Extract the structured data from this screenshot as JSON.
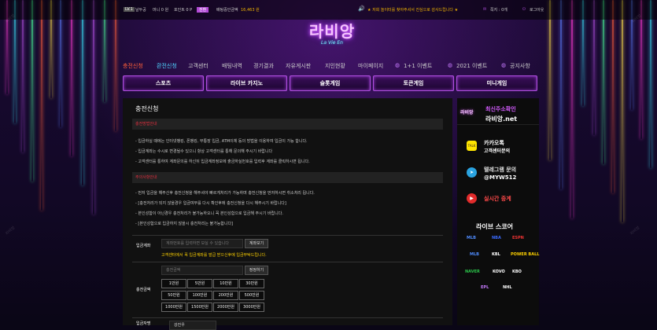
{
  "colors": {
    "accent": "#b04fe0",
    "brand_pink": "#f6c4ff",
    "warn_red": "#e02f3e",
    "warn_yellow": "#ffd200",
    "nav_active": "#ff5f3a"
  },
  "topbar": {
    "level": "LV.1",
    "username": "날두공",
    "money": "머니 0 원",
    "point": "포인트 0 P",
    "exchange": "전환",
    "hold_label": "배팅중인금액",
    "hold_value": "16,463 원",
    "marquee": "★ 저희 놀이터를 찾아주셔서 진심으로 감사드립니다 ★",
    "messages": "쪽지 : 0개",
    "logout": "로그아웃"
  },
  "logo": {
    "main": "라비앙",
    "sub": "La Vie En"
  },
  "nav": {
    "items": [
      {
        "label": "충전신청"
      },
      {
        "label": "환전신청"
      },
      {
        "label": "고객센터"
      },
      {
        "label": "배팅내역"
      },
      {
        "label": "경기결과"
      },
      {
        "label": "자유게시판"
      },
      {
        "label": "지인현황"
      },
      {
        "label": "마이페이지"
      },
      {
        "label": "1+1 이벤트"
      },
      {
        "label": "2021 이벤트"
      },
      {
        "label": "공지사항"
      }
    ]
  },
  "categories": [
    "스포츠",
    "라이브 카지노",
    "슬롯게임",
    "토큰게임",
    "미니게임"
  ],
  "main": {
    "title": "충전신청",
    "section1": "충전방법안내",
    "section1_lines": [
      "- 입금하실 때에는 인터넷뱅킹, 폰뱅킹, 무통장 입금, ATM이체 등의 방법을 이용하여 입금이 가능 합니다.",
      "- 입금계좌는 수시로 변경될수 있으니 항상 고객센터를 통해 문의해 주시기 바랍니다",
      "- 고객센터를 통하여 계좌문의를 하신뒤 입금계좌정보에 출금하실번호를 입력후 계좌를 클릭하시면 됩니다."
    ],
    "section2": "주의사항안내",
    "section2_lines": [
      "- 먼저 입금을 해주신후 충전신청을 해주셔야 빠르게처리가 가능하며 충전신청을 먼저하시면 취소처리 됩니다.",
      "- [충전처리가 되지 않을경우 입금여부를 다시 확인후에 충전신청을 다시 해주시기 바랍니다]",
      "- 본인성함이 아닌경우 충전처리가 불가능하오니 꼭 본인성함으로 입금해 주시기 바랍니다.",
      "- [본인성함으로 입금하지 않을시 충전처리는 불가능합니다]"
    ],
    "account_label": "입금계좌",
    "account_placeholder": "계좌번호를 입력하면 보실 수 있습니다",
    "account_button": "계좌보기",
    "account_warning": "고객센터에서 꼭 입금계좌를 발급 받으신후에 입금부탁드립니다.",
    "amount_label": "충전금액",
    "amount_placeholder": "충전금액",
    "reset_button": "정정하기",
    "amounts": [
      "1만원",
      "5만원",
      "10만원",
      "30만원",
      "50만원",
      "100만원",
      "200만원",
      "500만원",
      "1000만원",
      "1500만원",
      "2000만원",
      "3000만원"
    ],
    "bottom_label": "입금자명",
    "bottom_value": "강진우"
  },
  "side": {
    "latest_badge": "라비앙",
    "latest_title": "최신주소확인",
    "latest_url": "라비앙.net",
    "kakao_badge": "TALK",
    "kakao_title": "카카오톡",
    "kakao_sub": "고객센터문의",
    "tele_title": "텔레그램 문의",
    "tele_id": "@MYW512",
    "live_title": "실시간 중계",
    "score_title": "라이브 스코어",
    "league_logos": [
      "MLB",
      "NBA",
      "ESPN",
      "MLB",
      "KBL",
      "POWER BALL",
      "NAVER",
      "KOVO",
      "KBO",
      "EPL",
      "NHL"
    ]
  },
  "watermark": "라비앙"
}
